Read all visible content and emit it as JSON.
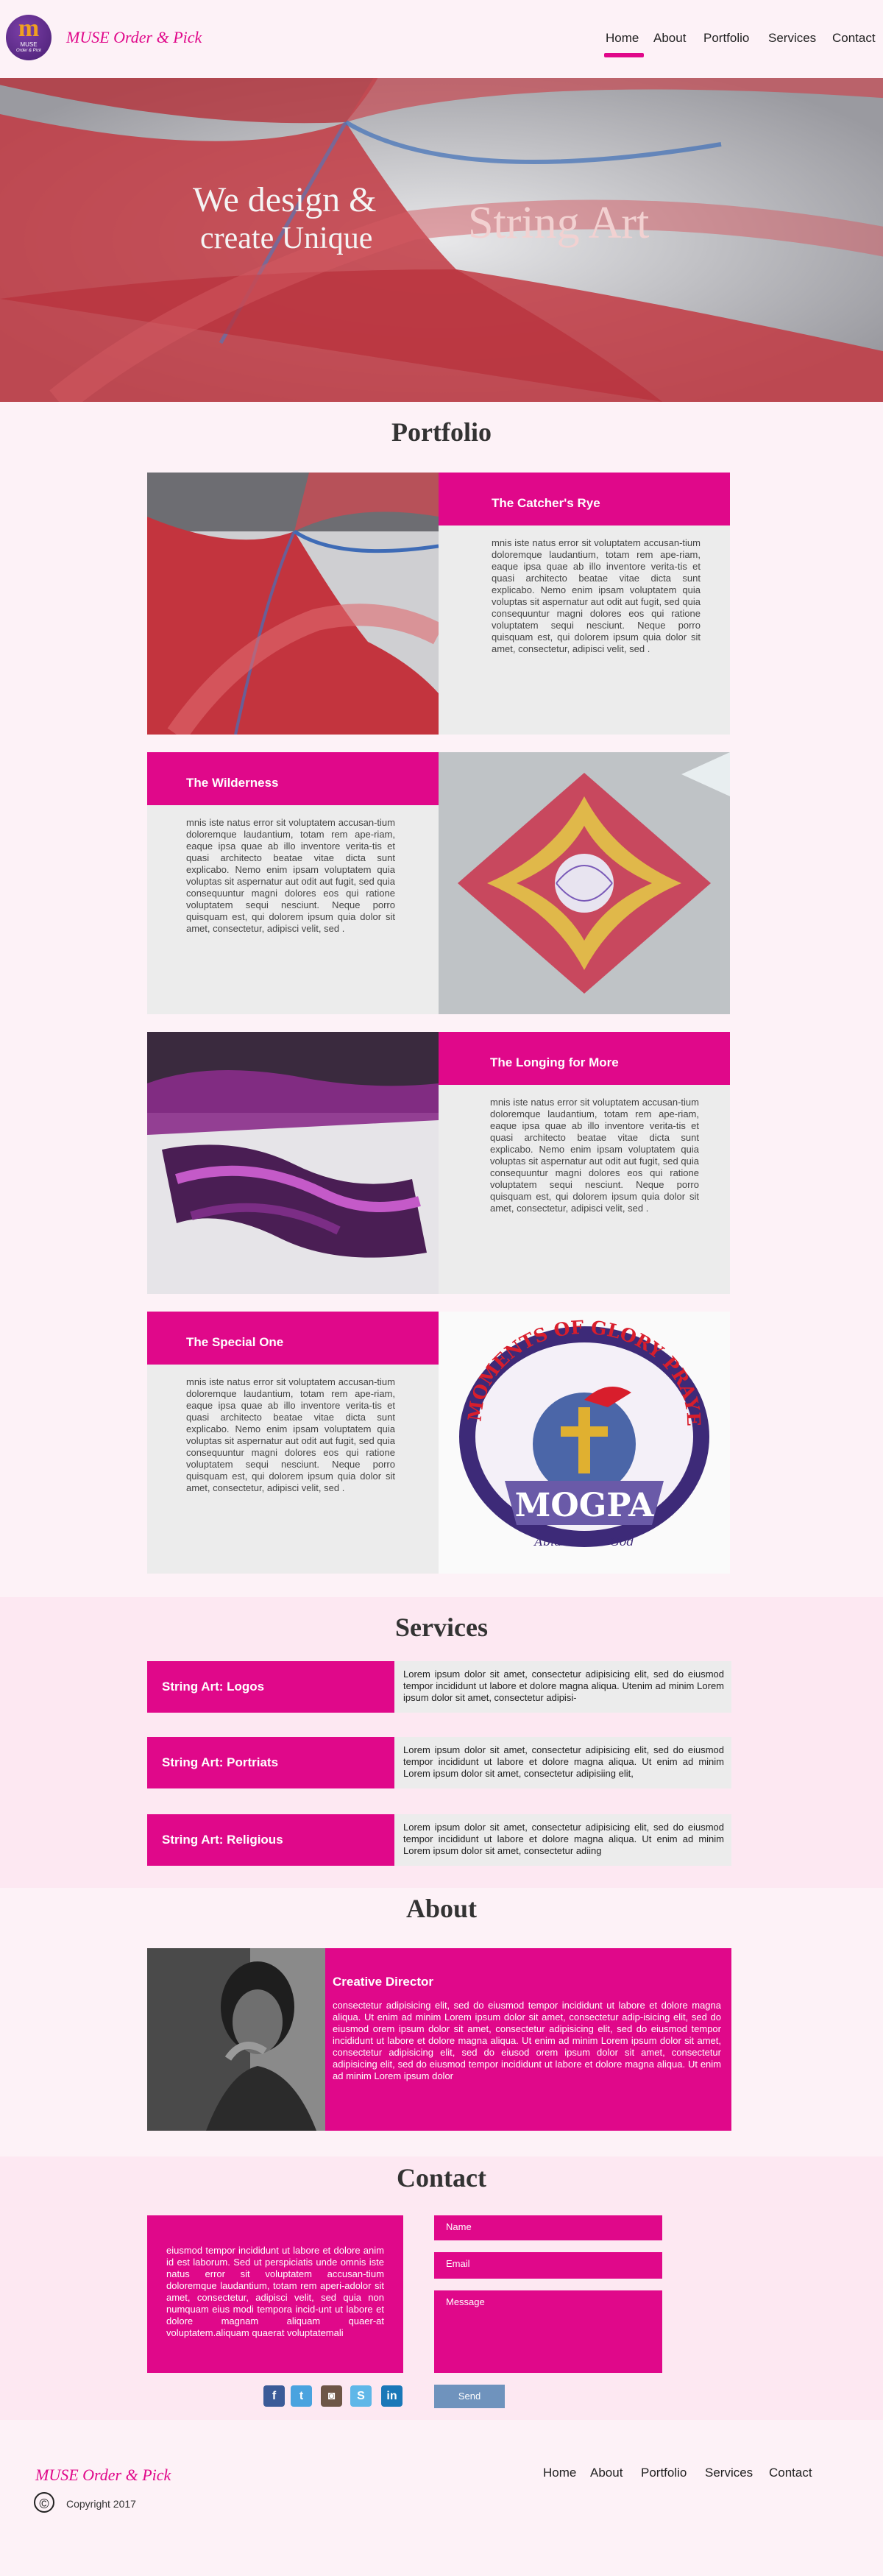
{
  "header": {
    "logo": {
      "letter": "m",
      "line1": "MUSE",
      "line2": "Order & Pick"
    },
    "brand": "MUSE Order & Pick",
    "nav": [
      "Home",
      "About",
      "Portfolio",
      "Services",
      "Contact"
    ],
    "active_nav": "Home"
  },
  "hero": {
    "line1": "We design &",
    "line2": "create Unique",
    "line3": "String Art"
  },
  "portfolio": {
    "title": "Portfolio",
    "items": [
      {
        "title": "The Catcher's Rye",
        "text": "mnis iste natus error sit voluptatem accusan-tium doloremque laudantium, totam rem ape-riam, eaque ipsa quae ab illo inventore verita-tis et quasi architecto beatae vitae dicta sunt explicabo. Nemo enim ipsam voluptatem quia voluptas sit aspernatur aut odit aut fugit, sed quia consequuntur magni dolores eos qui ratione voluptatem sequi nesciunt. Neque porro quisquam est, qui dolorem ipsum quia dolor sit amet, consectetur, adipisci velit, sed ."
      },
      {
        "title": "The Wilderness",
        "text": "mnis iste natus error sit voluptatem accusan-tium doloremque laudantium, totam rem ape-riam, eaque ipsa quae ab illo inventore verita-tis et quasi architecto beatae vitae dicta sunt explicabo. Nemo enim ipsam voluptatem quia voluptas sit aspernatur aut odit aut fugit, sed quia consequuntur magni dolores eos qui ratione voluptatem sequi nesciunt. Neque porro quisquam est, qui dolorem ipsum quia dolor sit amet, consectetur, adipisci velit, sed ."
      },
      {
        "title": "The Longing for More",
        "text": "mnis iste natus error sit voluptatem accusan-tium doloremque laudantium, totam rem ape-riam, eaque ipsa quae ab illo inventore verita-tis et quasi architecto beatae vitae dicta sunt explicabo. Nemo enim ipsam voluptatem quia voluptas sit aspernatur aut odit aut fugit, sed quia consequuntur magni dolores eos qui ratione voluptatem sequi nesciunt. Neque porro quisquam est, qui dolorem ipsum quia dolor sit amet, consectetur, adipisci velit, sed ."
      },
      {
        "title": "The Special One",
        "text": "mnis iste natus error sit voluptatem accusan-tium doloremque laudantium, totam rem ape-riam, eaque ipsa quae ab illo inventore verita-tis et quasi architecto beatae vitae dicta sunt explicabo. Nemo enim ipsam voluptatem quia voluptas sit aspernatur aut odit aut fugit, sed quia consequuntur magni dolores eos qui ratione voluptatem sequi nesciunt. Neque porro quisquam est, qui dolorem ipsum quia dolor sit amet, consectetur, adipisci velit, sed ."
      }
    ],
    "mogpa": {
      "arc": "MOMENTS OF GLORY PRAYER ARMY",
      "acronym": "MOGPA",
      "motto": "Abiaze - For God"
    }
  },
  "services": {
    "title": "Services",
    "items": [
      {
        "label": "String Art: Logos",
        "text": "Lorem ipsum dolor sit amet, consectetur adipisicing elit, sed do eiusmod tempor incididunt ut labore et dolore magna aliqua. Utenim ad minim Lorem ipsum dolor sit amet, consectetur adipisi-"
      },
      {
        "label": "String Art: Portriats",
        "text": "Lorem ipsum dolor sit amet, consectetur adipisicing elit, sed do eiusmod tempor incididunt ut labore et dolore magna aliqua. Ut enim ad minim Lorem ipsum dolor sit amet, consectetur adipisiing elit,"
      },
      {
        "label": "String Art: Religious",
        "text": "Lorem ipsum dolor sit amet, consectetur adipisicing elit, sed do eiusmod tempor incididunt ut labore et dolore magna aliqua. Ut enim ad minim Lorem ipsum dolor sit amet, consectetur adiing"
      }
    ]
  },
  "about": {
    "title": "About",
    "role": "Creative Director",
    "text": "consectetur adipisicing elit, sed do eiusmod tempor incididunt ut labore et dolore magna aliqua. Ut enim ad minim Lorem ipsum dolor sit amet, consectetur adip-isicing elit, sed do eiusmod orem ipsum dolor sit amet, consectetur adipisicing elit, sed do eiusmod tempor incididunt ut labore et dolore magna aliqua. Ut enim ad minim Lorem ipsum dolor sit amet, consectetur adipisicing elit, sed do eiusod orem ipsum dolor sit amet, consectetur adipisicing elit, sed do eiusmod tempor incididunt ut labore et dolore magna aliqua. Ut enim ad minim Lorem ipsum dolor"
  },
  "contact": {
    "title": "Contact",
    "text": "eiusmod tempor incididunt ut labore et dolore anim id est laborum. Sed ut perspiciatis unde omnis iste natus error sit voluptatem accusan-tium doloremque laudantium, totam rem aperi-adolor sit amet, consectetur, adipisci velit, sed quia non numquam eius modi tempora incid-unt ut labore et dolore magnam aliquam quaer-at voluptatem.aliquam quaerat voluptatemali",
    "name_placeholder": "Name",
    "email_placeholder": "Email",
    "message_placeholder": "Message",
    "send_label": "Send",
    "social": [
      {
        "icon": "facebook-icon",
        "glyph": "f",
        "color": "#3b5b98"
      },
      {
        "icon": "twitter-icon",
        "glyph": "t",
        "color": "#4aa3df"
      },
      {
        "icon": "instagram-icon",
        "glyph": "◙",
        "color": "#6e5646"
      },
      {
        "icon": "skype-icon",
        "glyph": "S",
        "color": "#5fb7e8"
      },
      {
        "icon": "linkedin-icon",
        "glyph": "in",
        "color": "#1a78b8"
      }
    ]
  },
  "footer": {
    "brand": "MUSE Order & Pick",
    "copyright": "Copyright 2017",
    "nav": [
      "Home",
      "About",
      "Portfolio",
      "Services",
      "Contact"
    ]
  },
  "colors": {
    "accent": "#e0088a",
    "background": "#fdf2f7",
    "panel": "#ececec",
    "section_bg": "#fde8f2",
    "send": "#6f93bd"
  }
}
